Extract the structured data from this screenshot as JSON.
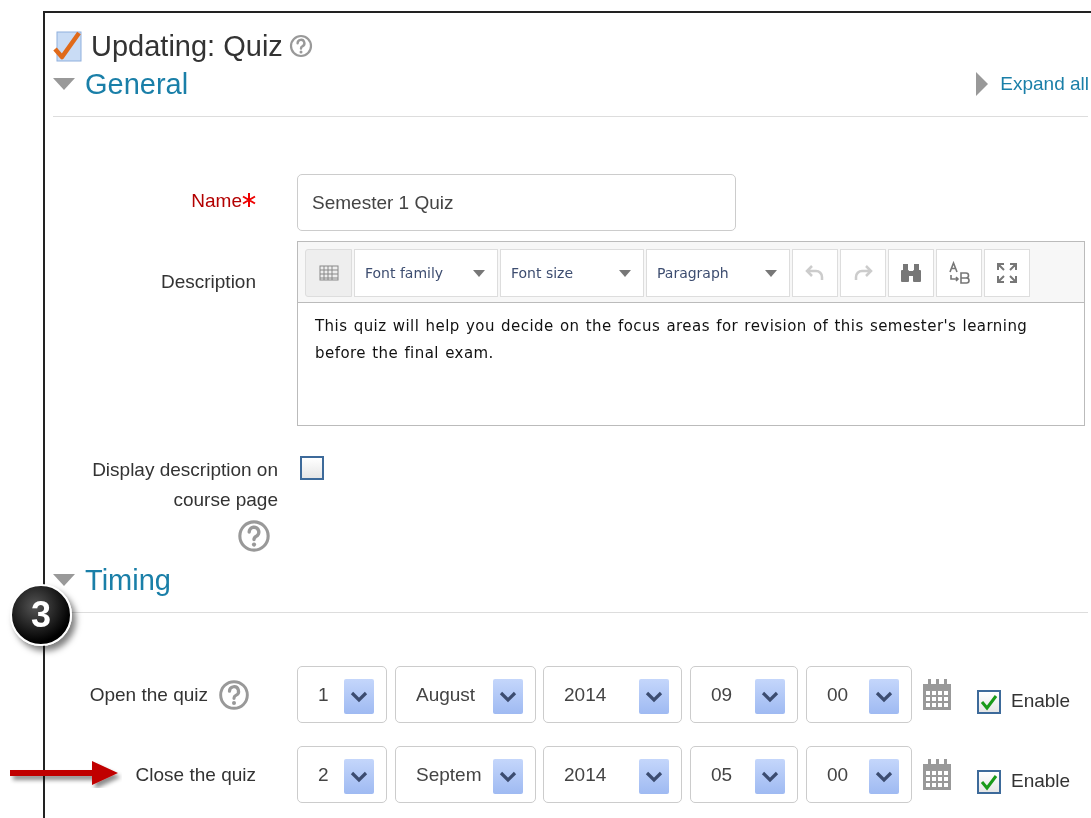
{
  "page": {
    "title": "Updating: Quiz",
    "help": true,
    "expand_all": "Expand all"
  },
  "sections": [
    {
      "title": "General",
      "expanded": true,
      "fields": [
        {
          "kind": "text",
          "label": "Name",
          "required": true,
          "value": "Semester 1 Quiz"
        },
        {
          "kind": "editor",
          "label": "Description",
          "toolbar": [
            {
              "kind": "toggle"
            },
            {
              "kind": "dropdown",
              "text": "Font family"
            },
            {
              "kind": "dropdown",
              "text": "Font size"
            },
            {
              "kind": "dropdown",
              "text": "Paragraph"
            },
            {
              "kind": "undo",
              "disabled": true
            },
            {
              "kind": "redo",
              "disabled": true
            },
            {
              "kind": "find",
              "disabled": false
            },
            {
              "kind": "replace",
              "disabled": false
            },
            {
              "kind": "fullscreen",
              "disabled": false
            }
          ],
          "value": "This quiz will help you decide on the focus areas for revision of this semester's learning before the final exam."
        },
        {
          "kind": "checkbox",
          "label": "Display description on course page",
          "help": true,
          "checked": false
        }
      ]
    },
    {
      "title": "Timing",
      "expanded": true,
      "fields": [
        {
          "kind": "datetime",
          "label": "Open the quiz",
          "help": true,
          "parts": [
            "1",
            "August",
            "2014",
            "09",
            "00"
          ],
          "enabled": true,
          "enable_label": "Enable"
        },
        {
          "kind": "datetime",
          "label": "Close the quiz",
          "help": false,
          "parts": [
            "2",
            "Septem",
            "2014",
            "05",
            "00"
          ],
          "enabled": true,
          "enable_label": "Enable"
        }
      ]
    }
  ],
  "callouts": [
    {
      "kind": "badge",
      "text": "3"
    },
    {
      "kind": "arrow"
    }
  ]
}
